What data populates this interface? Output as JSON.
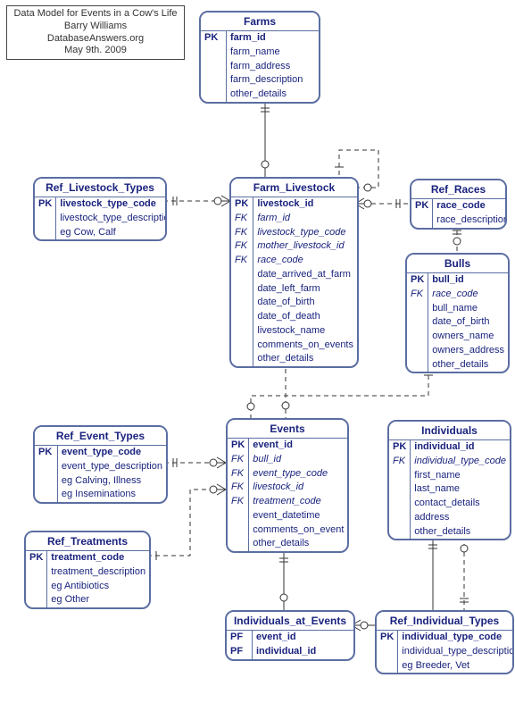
{
  "info": {
    "title": "Data Model for Events in a Cow's Life",
    "author": "Barry Williams",
    "site": "DatabaseAnswers.org",
    "date": "May 9th. 2009"
  },
  "entities": {
    "farms": {
      "title": "Farms",
      "rows": [
        {
          "k": "PK",
          "a": "farm_id",
          "bold": true
        },
        {
          "k": "",
          "a": "farm_name"
        },
        {
          "k": "",
          "a": "farm_address"
        },
        {
          "k": "",
          "a": "farm_description"
        },
        {
          "k": "",
          "a": "other_details"
        }
      ]
    },
    "ref_livestock_types": {
      "title": "Ref_Livestock_Types",
      "rows": [
        {
          "k": "PK",
          "a": "livestock_type_code",
          "bold": true
        },
        {
          "k": "",
          "a": "livestock_type_description"
        },
        {
          "k": "",
          "a": "eg Cow, Calf"
        }
      ]
    },
    "farm_livestock": {
      "title": "Farm_Livestock",
      "rows": [
        {
          "k": "PK",
          "a": "livestock_id",
          "bold": true
        },
        {
          "k": "FK",
          "a": "farm_id",
          "italic": true,
          "fk": true
        },
        {
          "k": "FK",
          "a": "livestock_type_code",
          "italic": true,
          "fk": true
        },
        {
          "k": "FK",
          "a": "mother_livestock_id",
          "italic": true,
          "fk": true
        },
        {
          "k": "FK",
          "a": "race_code",
          "italic": true,
          "fk": true
        },
        {
          "k": "",
          "a": "date_arrived_at_farm"
        },
        {
          "k": "",
          "a": "date_left_farm"
        },
        {
          "k": "",
          "a": "date_of_birth"
        },
        {
          "k": "",
          "a": "date_of_death"
        },
        {
          "k": "",
          "a": "livestock_name"
        },
        {
          "k": "",
          "a": "comments_on_events"
        },
        {
          "k": "",
          "a": "other_details"
        }
      ]
    },
    "ref_races": {
      "title": "Ref_Races",
      "rows": [
        {
          "k": "PK",
          "a": "race_code",
          "bold": true
        },
        {
          "k": "",
          "a": "race_description"
        }
      ]
    },
    "bulls": {
      "title": "Bulls",
      "rows": [
        {
          "k": "PK",
          "a": "bull_id",
          "bold": true
        },
        {
          "k": "FK",
          "a": "race_code",
          "italic": true,
          "fk": true
        },
        {
          "k": "",
          "a": "bull_name"
        },
        {
          "k": "",
          "a": "date_of_birth"
        },
        {
          "k": "",
          "a": "owners_name"
        },
        {
          "k": "",
          "a": "owners_address"
        },
        {
          "k": "",
          "a": "other_details"
        }
      ]
    },
    "ref_event_types": {
      "title": "Ref_Event_Types",
      "rows": [
        {
          "k": "PK",
          "a": "event_type_code",
          "bold": true
        },
        {
          "k": "",
          "a": "event_type_description"
        },
        {
          "k": "",
          "a": "eg Calving, Illness"
        },
        {
          "k": "",
          "a": "eg Inseminations"
        }
      ]
    },
    "events": {
      "title": "Events",
      "rows": [
        {
          "k": "PK",
          "a": "event_id",
          "bold": true
        },
        {
          "k": "FK",
          "a": "bull_id",
          "italic": true,
          "fk": true
        },
        {
          "k": "FK",
          "a": "event_type_code",
          "italic": true,
          "fk": true
        },
        {
          "k": "FK",
          "a": "livestock_id",
          "italic": true,
          "fk": true
        },
        {
          "k": "FK",
          "a": "treatment_code",
          "italic": true,
          "fk": true
        },
        {
          "k": "",
          "a": "event_datetime"
        },
        {
          "k": "",
          "a": "comments_on_event"
        },
        {
          "k": "",
          "a": "other_details"
        }
      ]
    },
    "individuals": {
      "title": "Individuals",
      "rows": [
        {
          "k": "PK",
          "a": "individual_id",
          "bold": true
        },
        {
          "k": "FK",
          "a": "individual_type_code",
          "italic": true,
          "fk": true
        },
        {
          "k": "",
          "a": "first_name"
        },
        {
          "k": "",
          "a": "last_name"
        },
        {
          "k": "",
          "a": "contact_details"
        },
        {
          "k": "",
          "a": "address"
        },
        {
          "k": "",
          "a": "other_details"
        }
      ]
    },
    "ref_treatments": {
      "title": "Ref_Treatments",
      "rows": [
        {
          "k": "PK",
          "a": "treatment_code",
          "bold": true
        },
        {
          "k": "",
          "a": "treatment_description"
        },
        {
          "k": "",
          "a": "eg Antibiotics"
        },
        {
          "k": "",
          "a": "eg Other"
        }
      ]
    },
    "individuals_at_events": {
      "title": "Individuals_at_Events",
      "rows": [
        {
          "k": "PF",
          "a": "event_id",
          "bold": true
        },
        {
          "k": "PF",
          "a": "individual_id",
          "bold": true
        }
      ]
    },
    "ref_individual_types": {
      "title": "Ref_Individual_Types",
      "rows": [
        {
          "k": "PK",
          "a": "individual_type_code",
          "bold": true
        },
        {
          "k": "",
          "a": "individual_type_description"
        },
        {
          "k": "",
          "a": "eg Breeder, Vet"
        }
      ]
    }
  }
}
